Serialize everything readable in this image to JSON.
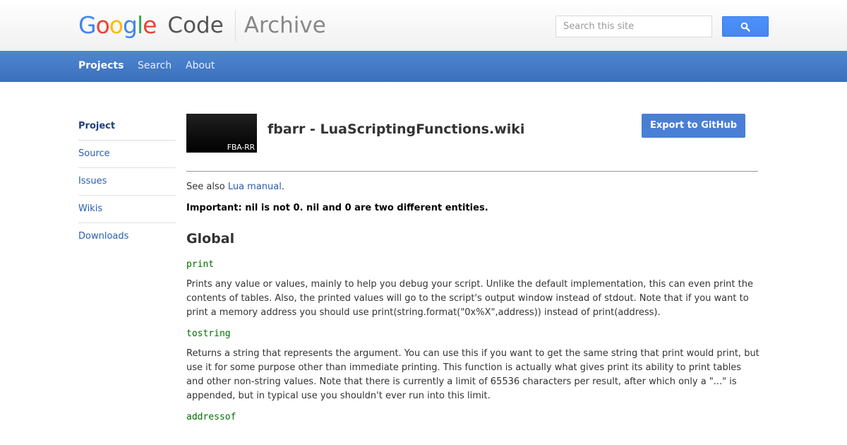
{
  "header": {
    "logo_google": [
      "G",
      "o",
      "o",
      "g",
      "l",
      "e"
    ],
    "logo_colors": [
      "#4285f4",
      "#ea4335",
      "#fbbc05",
      "#4285f4",
      "#34a853",
      "#ea4335"
    ],
    "logo_code": "Code",
    "logo_archive": "Archive",
    "search_placeholder": "Search this site",
    "search_icon": "search-icon"
  },
  "nav": {
    "projects": "Projects",
    "search": "Search",
    "about": "About"
  },
  "sidebar": {
    "items": [
      "Project",
      "Source",
      "Issues",
      "Wikis",
      "Downloads"
    ]
  },
  "project": {
    "logo_text": "FBA-RR",
    "title": "fbarr - LuaScriptingFunctions.wiki",
    "export_label": "Export to GitHub"
  },
  "content": {
    "see_also_prefix": "See also ",
    "see_also_link": "Lua manual",
    "see_also_suffix": ".",
    "important": "Important: nil is not 0. nil and 0 are two different entities.",
    "section": "Global",
    "functions": [
      {
        "name": "print",
        "desc": "Prints any value or values, mainly to help you debug your script. Unlike the default implementation, this can even print the contents of tables. Also, the printed values will go to the script's output window instead of stdout. Note that if you want to print a memory address you should use print(string.format(\"0x%X\",address)) instead of print(address)."
      },
      {
        "name": "tostring",
        "desc": "Returns a string that represents the argument. You can use this if you want to get the same string that print would print, but use it for some purpose other than immediate printing. This function is actually what gives print its ability to print tables and other non-string values. Note that there is currently a limit of 65536 characters per result, after which only a \"...\" is appended, but in typical use you shouldn't ever run into this limit."
      },
      {
        "name": "addressof",
        "desc": ""
      }
    ]
  }
}
